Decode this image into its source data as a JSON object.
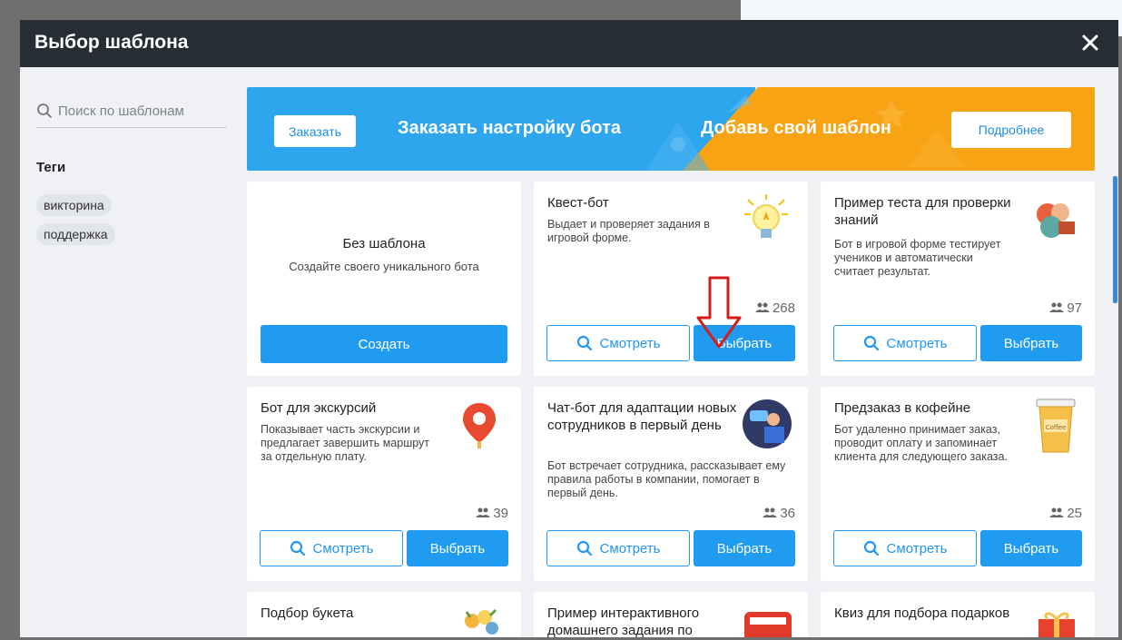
{
  "modal": {
    "title": "Выбор шаблона"
  },
  "search": {
    "placeholder": "Поиск по шаблонам"
  },
  "tags": {
    "title": "Теги",
    "items": [
      "викторина",
      "поддержка"
    ]
  },
  "banner": {
    "order_button": "Заказать",
    "order_text": "Заказать настройку бота",
    "add_text": "Добавь свой шаблон",
    "more_button": "Подробнее"
  },
  "buttons": {
    "view": "Смотреть",
    "pick": "Выбрать",
    "create": "Создать"
  },
  "templates": [
    {
      "title": "Без шаблона",
      "desc": "Создайте своего уникального бота"
    },
    {
      "title": "Квест-бот",
      "desc": "Выдает и проверяет задания в игровой форме.",
      "count": "268"
    },
    {
      "title": "Пример теста для проверки знаний",
      "desc": "Бот в игровой форме тестирует учеников и автоматически считает результат.",
      "count": "97"
    },
    {
      "title": "Бот для экскурсий",
      "desc": "Показывает часть экскурсии и предлагает завершить маршрут за отдельную плату.",
      "count": "39"
    },
    {
      "title": "Чат-бот для адаптации новых сотрудников в первый день",
      "desc": "Бот встречает сотрудника, рассказывает ему правила работы в компании, помогает в первый день.",
      "count": "36"
    },
    {
      "title": "Предзаказ в кофейне",
      "desc": "Бот удаленно принимает заказ, проводит оплату и запоминает клиента для следующего заказа.",
      "count": "25"
    },
    {
      "title": "Подбор букета"
    },
    {
      "title": "Пример интерактивного домашнего задания по"
    },
    {
      "title": "Квиз для подбора подарков"
    }
  ],
  "colors": {
    "accent": "#1f9bf0",
    "header": "#262d35",
    "banner_blue": "#2ea6ee",
    "banner_orange": "#f8a313"
  }
}
